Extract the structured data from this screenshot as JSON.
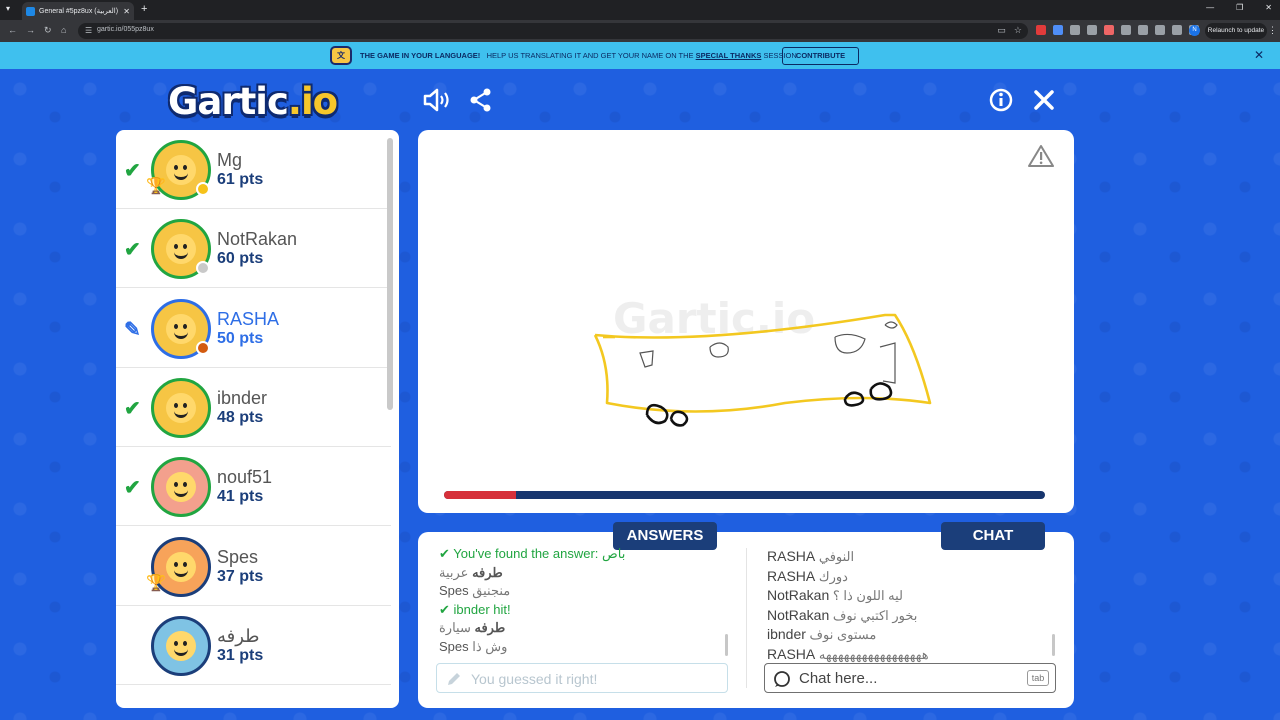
{
  "browser": {
    "tab_title": "General #5pz8ux (العربية) - Gartic",
    "url": "gartic.io/055pz8ux",
    "relaunch_label": "Relaunch to update",
    "profile_initial": "N"
  },
  "banner": {
    "headline": "THE GAME IN YOUR LANGUAGE!",
    "text_before": "HELP US TRANSLATING IT AND GET YOUR NAME ON THE",
    "link": "SPECIAL THANKS",
    "text_after": "SESSION",
    "contribute_label": "CONTRIBUTE"
  },
  "header": {
    "logo_main": "Gartic",
    "logo_suffix": ".io"
  },
  "players": [
    {
      "name": "Mg",
      "points": "61 pts",
      "status": "check",
      "trophy": true,
      "dot_color": "#f6c21a",
      "border": "#21a541",
      "bg": "#f6c544"
    },
    {
      "name": "NotRakan",
      "points": "60 pts",
      "status": "check",
      "trophy": false,
      "dot_color": "#c9c9c9",
      "border": "#21a541",
      "bg": "#f6c544"
    },
    {
      "name": "RASHA",
      "points": "50 pts",
      "status": "pencil",
      "trophy": false,
      "dot_color": "#d35b10",
      "border": "#2e6ee6",
      "bg": "#f6c544"
    },
    {
      "name": "ibnder",
      "points": "48 pts",
      "status": "check",
      "trophy": false,
      "dot_color": "",
      "border": "#21a541",
      "bg": "#f6c544"
    },
    {
      "name": "nouf51",
      "points": "41 pts",
      "status": "check",
      "trophy": false,
      "dot_color": "",
      "border": "#21a541",
      "bg": "#f3a08d"
    },
    {
      "name": "Spes",
      "points": "37 pts",
      "status": "",
      "trophy": true,
      "dot_color": "",
      "border": "#1b3e7a",
      "bg": "#f7a35a"
    },
    {
      "name": "طرفه",
      "points": "31 pts",
      "status": "",
      "trophy": false,
      "dot_color": "",
      "border": "#1b3e7a",
      "bg": "#7fc3e4"
    }
  ],
  "canvas": {
    "timer_remaining": 0.12,
    "watermark": "Gartic.io"
  },
  "answers": {
    "tab_label": "ANSWERS",
    "messages": [
      {
        "type": "found",
        "text": "You've found the answer: باص"
      },
      {
        "who": "طرفه",
        "text": "عربية",
        "bold": true
      },
      {
        "who": "Spes",
        "text": "منجنيق",
        "bold": false
      },
      {
        "type": "hit",
        "who": "ibnder",
        "text": "hit!"
      },
      {
        "who": "طرفه",
        "text": "سيارة",
        "bold": true
      },
      {
        "who": "Spes",
        "text": "وش ذا",
        "bold": false
      }
    ],
    "input_placeholder": "You guessed it right!"
  },
  "chat": {
    "tab_label": "CHAT",
    "messages": [
      {
        "who": "RASHA",
        "text": "النوفي"
      },
      {
        "who": "RASHA",
        "text": "دورك"
      },
      {
        "who": "NotRakan",
        "text": "ليه اللون ذا ؟"
      },
      {
        "who": "NotRakan",
        "text": "بخور اكتبي نوف"
      },
      {
        "who": "ibnder",
        "text": "مستوى نوف"
      },
      {
        "who": "RASHA",
        "text": "هههههههههههههههههه"
      }
    ],
    "input_placeholder": "Chat here...",
    "tab_key": "tab"
  },
  "colors": {
    "background": "#1f5fe0",
    "navy": "#1b3e7a",
    "correct": "#21a541",
    "drawer": "#2e6ee6",
    "timer": "#d6303a"
  }
}
